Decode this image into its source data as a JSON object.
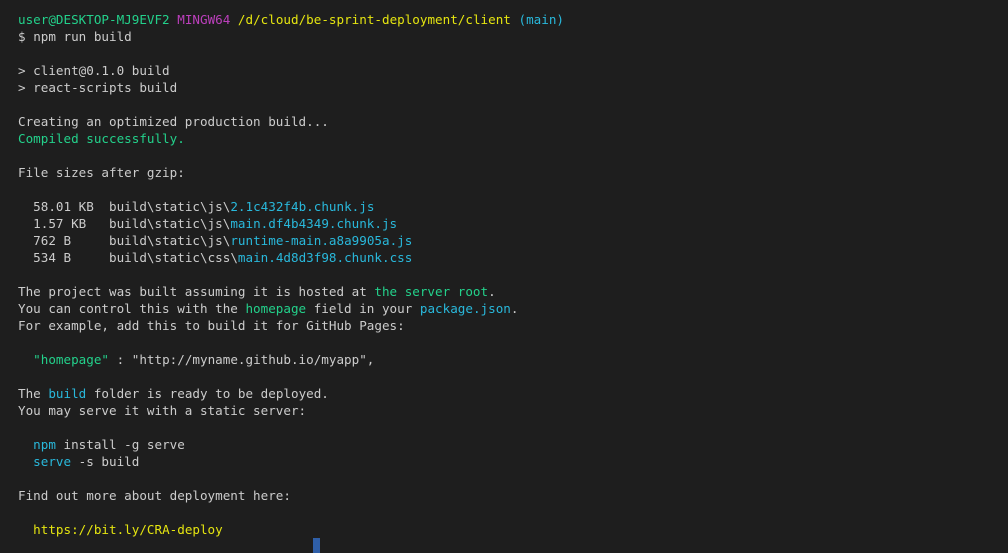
{
  "prompt": {
    "user_host": "user@DESKTOP-MJ9EVF2",
    "shell": "MINGW64",
    "path": "/d/cloud/be-sprint-deployment/client",
    "branch": "(main)",
    "symbol": "$",
    "command": "npm run build"
  },
  "script_header": {
    "line1": "> client@0.1.0 build",
    "line2": "> react-scripts build"
  },
  "status": {
    "creating": "Creating an optimized production build...",
    "compiled": "Compiled successfully."
  },
  "file_sizes": {
    "heading": "File sizes after gzip:",
    "rows": [
      {
        "size": "58.01 KB",
        "dir": "build\\static\\js\\",
        "file": "2.1c432f4b.chunk.js"
      },
      {
        "size": "1.57 KB",
        "dir": "build\\static\\js\\",
        "file": "main.df4b4349.chunk.js"
      },
      {
        "size": "762 B",
        "dir": "build\\static\\js\\",
        "file": "runtime-main.a8a9905a.js"
      },
      {
        "size": "534 B",
        "dir": "build\\static\\css\\",
        "file": "main.4d8d3f98.chunk.css"
      }
    ]
  },
  "hosting": {
    "l1_a": "The project was built assuming it is hosted at ",
    "l1_b": "the server root",
    "l1_c": ".",
    "l2_a": "You can control this with the ",
    "l2_b": "homepage",
    "l2_c": " field in your ",
    "l2_d": "package.json",
    "l2_e": ".",
    "l3": "For example, add this to build it for GitHub Pages:",
    "example_key": "\"homepage\"",
    "example_sep": " : ",
    "example_value": "\"http://myname.github.io/myapp\"",
    "example_end": ","
  },
  "deploy": {
    "l1_a": "The ",
    "l1_b": "build",
    "l1_c": " folder is ready to be deployed.",
    "l2": "You may serve it with a static server:",
    "cmd1_a": "npm",
    "cmd1_b": " install -g serve",
    "cmd2_a": "serve",
    "cmd2_b": " -s build",
    "more": "Find out more about deployment here:",
    "link": "https://bit.ly/CRA-deploy"
  },
  "colors": {
    "background": "#1e1e1e",
    "foreground": "#cccccc",
    "green": "#23d18b",
    "magenta": "#bc3fbc",
    "yellow": "#e5e510",
    "cyan": "#29b8db",
    "cursor": "#2f5fa8"
  }
}
